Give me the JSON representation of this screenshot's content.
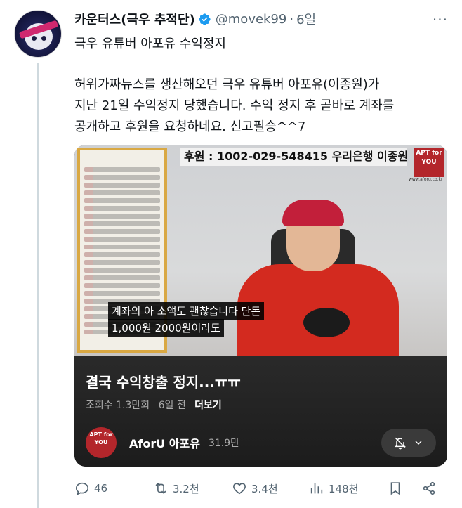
{
  "post": {
    "author_name": "카운터스(극우 추적단)",
    "handle": "@movek99",
    "separator": "·",
    "time": "6일",
    "more_label": "···",
    "line1": "극우 유튜버 아포유 수익정지",
    "line2": "허위가짜뉴스를 생산해오던 극우 유튜버 아포유(이종원)가",
    "line3": "지난 21일 수익정지 당했습니다. 수익 정지 후 곧바로 계좌를",
    "line4": "공개하고 후원을 요청하네요. 신고필승^^7"
  },
  "video": {
    "banner": "후원 : 1002-029-548415 우리은행 이종원",
    "logo_text": "APT for YOU",
    "logo_url": "www.aforu.co.kr",
    "subtitle1": "계좌의 아 소액도 괜찮습니다 단돈",
    "subtitle2": "1,000원 2000원이라도",
    "title": "결국 수익창출 정지...ㅠㅠ",
    "views": "조회수 1.3만회",
    "ago": "6일 전",
    "more": "더보기",
    "channel_name": "AforU 아포유",
    "subscribers": "31.9만"
  },
  "actions": {
    "replies": "46",
    "reposts": "3.2천",
    "likes": "3.4천",
    "views": "148천"
  },
  "colors": {
    "verified": "#1d9bf0",
    "muted": "#536471",
    "logo_red": "#b3262b"
  }
}
